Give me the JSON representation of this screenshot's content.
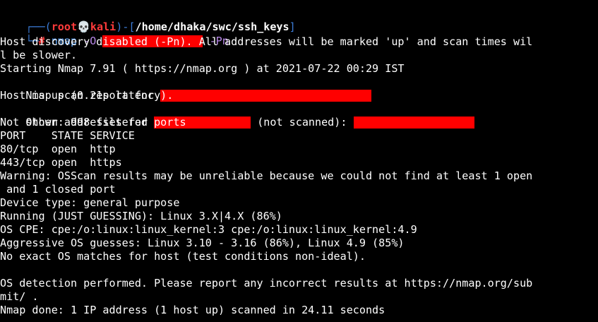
{
  "prompt": {
    "corner_top": "┌──(",
    "user": "root",
    "skull": "💀",
    "host": "kali",
    "sep": ")-[",
    "path": "/home/dhaka/swc/ssh_keys",
    "close": "]",
    "corner_bottom": "└─",
    "hash": "#",
    "command": "nmap",
    "flag_os": "-O",
    "flag_pn": "-Pn"
  },
  "output": {
    "l1": "Host discovery disabled (-Pn). All addresses will be marked 'up' and scan times wil",
    "l2": "l be slower.",
    "l3": "Starting Nmap 7.91 ( https://nmap.org ) at 2021-07-22 00:29 IST",
    "l4": "Nmap scan report for",
    "l5": "Host is up (0.21s latency).",
    "l6a": "Other addresses for",
    "l6b": "(not scanned):",
    "l7": "Not shown: 998 filtered ports",
    "l8": "PORT    STATE SERVICE",
    "l9": "80/tcp  open  http",
    "l10": "443/tcp open  https",
    "l11": "Warning: OSScan results may be unreliable because we could not find at least 1 open",
    "l12": " and 1 closed port",
    "l13": "Device type: general purpose",
    "l14": "Running (JUST GUESSING): Linux 3.X|4.X (86%)",
    "l15": "OS CPE: cpe:/o:linux:linux_kernel:3 cpe:/o:linux:linux_kernel:4.9",
    "l16": "Aggressive OS guesses: Linux 3.10 - 3.16 (86%), Linux 4.9 (85%)",
    "l17": "No exact OS matches for host (test conditions non-ideal).",
    "l19": "OS detection performed. Please report any incorrect results at https://nmap.org/sub",
    "l20": "mit/ .",
    "l21": "Nmap done: 1 IP address (1 host up) scanned in 24.11 seconds"
  },
  "colors": {
    "background": "#000000",
    "text": "#ffffff",
    "prompt_frame": "#3b7bd6",
    "prompt_user": "#ff3b3b",
    "command": "#5fa8ff",
    "arguments": "#b888e8",
    "redaction": "#ff0000"
  }
}
